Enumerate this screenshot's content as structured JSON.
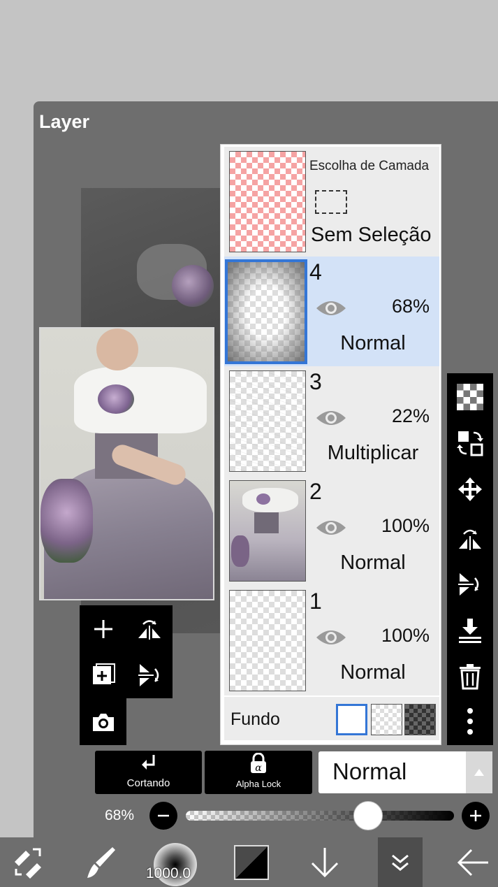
{
  "panel": {
    "title": "Layer"
  },
  "selection_layer": {
    "title": "Escolha de Camada",
    "status": "Sem Seleção"
  },
  "layers": [
    {
      "number": "4",
      "opacity": "68%",
      "blend": "Normal",
      "selected": true
    },
    {
      "number": "3",
      "opacity": "22%",
      "blend": "Multiplicar",
      "selected": false
    },
    {
      "number": "2",
      "opacity": "100%",
      "blend": "Normal",
      "selected": false
    },
    {
      "number": "1",
      "opacity": "100%",
      "blend": "Normal",
      "selected": false
    }
  ],
  "background": {
    "label": "Fundo",
    "options": [
      "white",
      "transparent",
      "dark-checker"
    ],
    "selected": "white"
  },
  "controls": {
    "clipping_label": "Cortando",
    "alpha_lock_label": "Alpha Lock",
    "blend_mode": "Normal",
    "opacity_label": "68%",
    "opacity_value": 0.68
  },
  "bottom_toolbar": {
    "brush_size": "1000.0"
  },
  "colors": {
    "accent": "#3476d6",
    "selected_row": "#d3e2f7",
    "panel": "#6e6e6e"
  }
}
